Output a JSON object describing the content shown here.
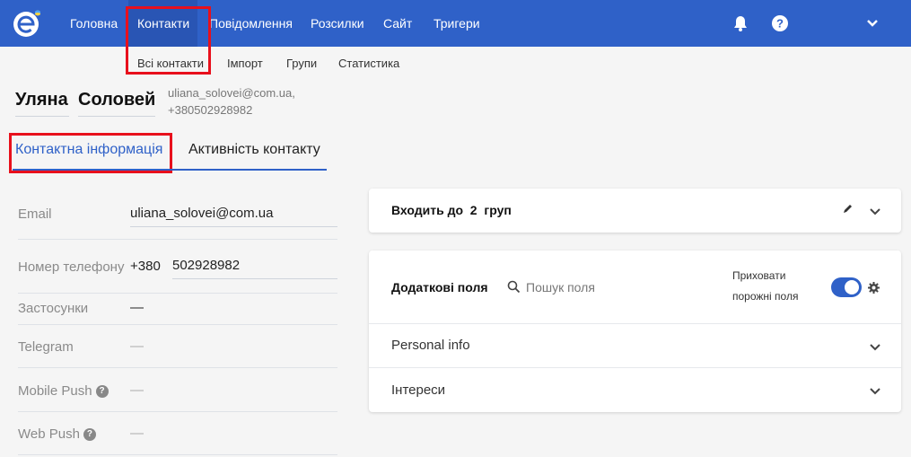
{
  "nav": {
    "items": [
      "Головна",
      "Контакти",
      "Повідомлення",
      "Розсилки",
      "Сайт",
      "Тригери"
    ],
    "accent": "#2f61c8"
  },
  "subnav": {
    "items": [
      "Всі контакти",
      "Імпорт",
      "Групи",
      "Статистика"
    ]
  },
  "contact": {
    "first_name": "Уляна",
    "last_name": "Соловей",
    "email_meta": "uliana_solovei@com.ua,",
    "phone_meta": "+380502928982"
  },
  "tabs": {
    "info": "Контактна інформація",
    "activity": "Активність контакту"
  },
  "fields": {
    "email_label": "Email",
    "email_value": "uliana_solovei@com.ua",
    "phone_label": "Номер телефону",
    "phone_code": "+380",
    "phone_number": "502928982",
    "apps_label": "Застосунки",
    "apps_value": "—",
    "telegram_label": "Telegram",
    "telegram_value": "—",
    "mobile_push_label": "Mobile Push",
    "mobile_push_value": "—",
    "web_push_label": "Web Push",
    "web_push_value": "—"
  },
  "groups_card": {
    "prefix": "Входить до",
    "count": "2",
    "suffix": "груп"
  },
  "extra_fields": {
    "title": "Додаткові поля",
    "search_placeholder": "Пошук поля",
    "hide_empty_line1": "Приховати",
    "hide_empty_line2": "порожні поля",
    "hide_empty_enabled": true,
    "sections": [
      "Personal info",
      "Інтереси"
    ]
  },
  "colors": {
    "highlight": "#e8101c",
    "nav_bg": "#2f61c8"
  }
}
